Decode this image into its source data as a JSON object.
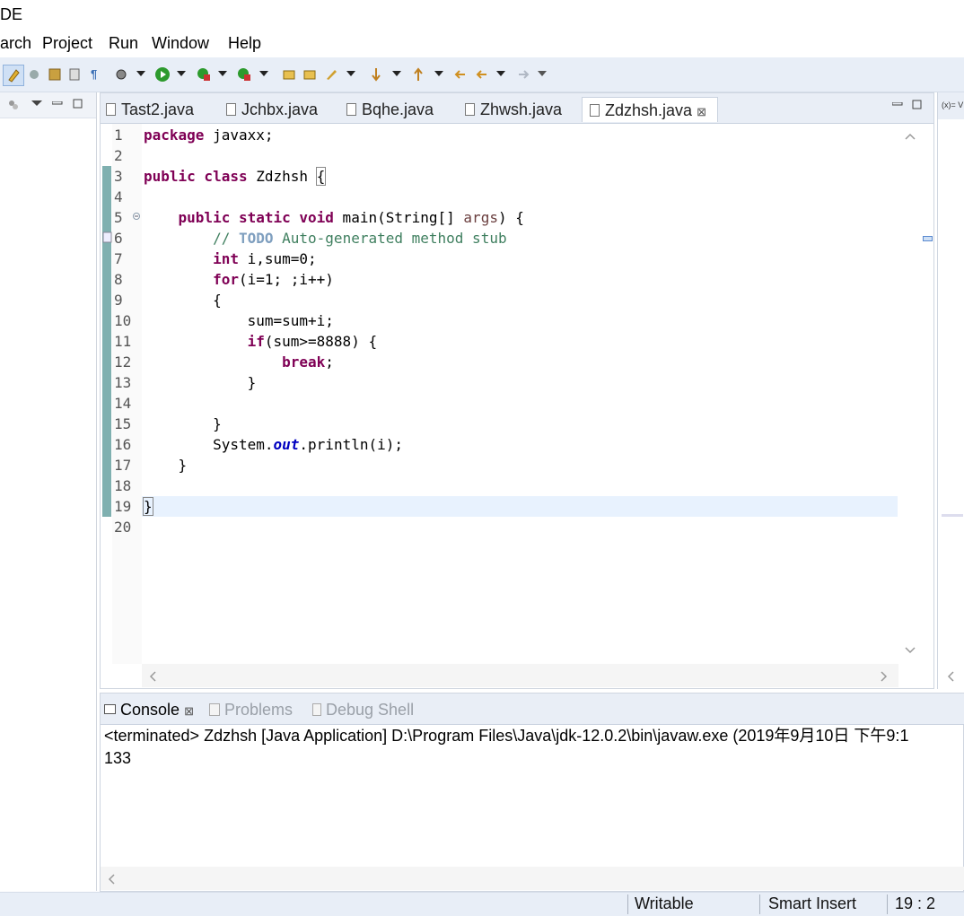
{
  "window": {
    "title": "DE"
  },
  "menu": {
    "items": [
      "arch",
      "Project",
      "Run",
      "Window",
      "Help"
    ]
  },
  "toolbar": {
    "icons": [
      "edit-pen-icon",
      "build-icon",
      "save-icon",
      "print-icon",
      "paragraph-icon",
      "debug-icon",
      "run-icon",
      "coverage-icon",
      "external-tools-icon",
      "new-project-icon",
      "open-type-icon",
      "search-icon",
      "next-annotation-icon",
      "last-edit-icon",
      "back-icon",
      "forward-icon"
    ],
    "paragraph_glyph": "¶"
  },
  "editor": {
    "tabs": [
      {
        "label": "Tast2.java",
        "active": false
      },
      {
        "label": "Jchbx.java",
        "active": false
      },
      {
        "label": "Bqhe.java",
        "active": false
      },
      {
        "label": "Zhwsh.java",
        "active": false
      },
      {
        "label": "Zdzhsh.java",
        "active": true,
        "close": "⊠"
      }
    ],
    "line_numbers": [
      "1",
      "2",
      "3",
      "4",
      "5",
      "6",
      "7",
      "8",
      "9",
      "10",
      "11",
      "12",
      "13",
      "14",
      "15",
      "16",
      "17",
      "18",
      "19",
      "20"
    ],
    "code": {
      "l1_kw": "package",
      "l1_rest": " javaxx;",
      "l3_kw": "public class",
      "l3_rest": " Zdzhsh ",
      "l3_brace": "{",
      "l5_indent": "    ",
      "l5_kw": "public static void",
      "l5_mid": " main(String[] ",
      "l5_var": "args",
      "l5_end": ") {",
      "l6_indent": "        ",
      "l6_c1": "// ",
      "l6_todo": "TODO",
      "l6_c2": " Auto-generated method stub",
      "l7_indent": "        ",
      "l7_kw": "int",
      "l7_rest": " i,sum=0;",
      "l8_indent": "        ",
      "l8_kw": "for",
      "l8_rest": "(i=1; ;i++)",
      "l9": "        {",
      "l10": "            sum=sum+i;",
      "l11_indent": "            ",
      "l11_kw": "if",
      "l11_rest": "(sum>=8888) {",
      "l12_indent": "                ",
      "l12_kw": "break",
      "l12_rest": ";",
      "l13": "            }",
      "l15": "        }",
      "l16_indent": "        ",
      "l16_a": "System.",
      "l16_fld": "out",
      "l16_b": ".println(i);",
      "l17": "    }",
      "l19": "}"
    }
  },
  "console": {
    "tabs": [
      {
        "label": "Console",
        "active": true,
        "close": "⊠"
      },
      {
        "label": "Problems",
        "active": false
      },
      {
        "label": "Debug Shell",
        "active": false
      }
    ],
    "header": "<terminated> Zdzhsh [Java Application] D:\\Program Files\\Java\\jdk-12.0.2\\bin\\javaw.exe (2019年9月10日 下午9:1",
    "output": "133"
  },
  "statusbar": {
    "mode": "Writable",
    "insert": "Smart Insert",
    "position": "19 : 2"
  },
  "right_panel": {
    "label": "(x)= V"
  },
  "colors": {
    "keyword": "#7f0055",
    "comment": "#3f7f5f",
    "field": "#0000c0",
    "changebar": "#7fb0b0"
  }
}
